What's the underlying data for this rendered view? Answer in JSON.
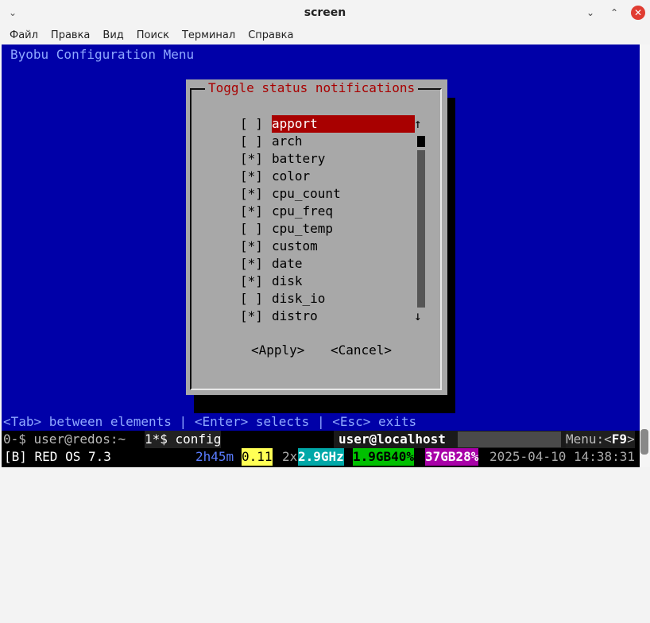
{
  "window": {
    "title": "screen"
  },
  "menubar": {
    "items": [
      "Файл",
      "Правка",
      "Вид",
      "Поиск",
      "Терминал",
      "Справка"
    ]
  },
  "terminal": {
    "header": "Byobu Configuration Menu",
    "dialog": {
      "title": "Toggle status notifications",
      "items": [
        {
          "check": "[ ]",
          "label": "apport",
          "selected": true
        },
        {
          "check": "[ ]",
          "label": "arch"
        },
        {
          "check": "[*]",
          "label": "battery"
        },
        {
          "check": "[*]",
          "label": "color"
        },
        {
          "check": "[*]",
          "label": "cpu_count"
        },
        {
          "check": "[*]",
          "label": "cpu_freq"
        },
        {
          "check": "[ ]",
          "label": "cpu_temp"
        },
        {
          "check": "[*]",
          "label": "custom"
        },
        {
          "check": "[*]",
          "label": "date"
        },
        {
          "check": "[*]",
          "label": "disk"
        },
        {
          "check": "[ ]",
          "label": "disk_io"
        },
        {
          "check": "[*]",
          "label": "distro"
        }
      ],
      "scroll_up": "↑",
      "scroll_down": "↓",
      "apply": "<Apply>",
      "cancel": "<Cancel>"
    },
    "help_line": "<Tab> between elements | <Enter> selects | <Esc> exits",
    "status1": {
      "win0": "0-$ user@redos:~",
      "win1": "1*$ config",
      "hostname": "user@localhost",
      "menu_prefix": "Menu:<",
      "menu_key": "F9",
      "menu_suffix": ">"
    },
    "status2": {
      "os": "[B] RED OS 7.3",
      "uptime": "2h45m",
      "load": "0.11",
      "cpu_count": "2x",
      "cpu_freq": "2.9GHz",
      "mem": "1.9GB40%",
      "disk": "37GB28%",
      "datetime": "2025-04-10 14:38:31"
    }
  }
}
